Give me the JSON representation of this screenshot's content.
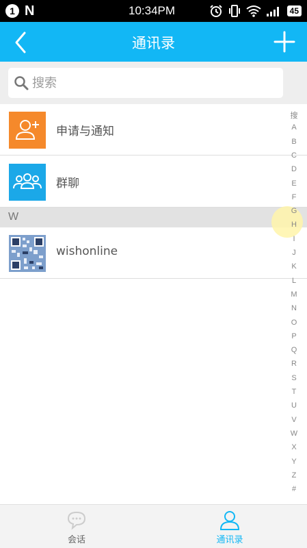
{
  "status_bar": {
    "alert_badge": "1",
    "n_icon": "N",
    "time": "10:34PM",
    "battery": "45"
  },
  "header": {
    "title": "通讯录",
    "back_icon": "chevron-left-icon",
    "add_icon": "plus-icon"
  },
  "search": {
    "placeholder": "搜索"
  },
  "list": {
    "special_items": [
      {
        "label": "申请与通知",
        "icon": "add-contact-icon",
        "color": "#f5892b"
      },
      {
        "label": "群聊",
        "icon": "group-icon",
        "color": "#1ba8e8"
      }
    ],
    "section_letter": "W",
    "contacts": [
      {
        "name": "wishonline",
        "avatar": "qr-code-avatar"
      }
    ]
  },
  "index_bar": [
    "搜",
    "A",
    "B",
    "C",
    "D",
    "E",
    "F",
    "G",
    "H",
    "I",
    "J",
    "K",
    "L",
    "M",
    "N",
    "O",
    "P",
    "Q",
    "R",
    "S",
    "T",
    "U",
    "V",
    "W",
    "X",
    "Y",
    "Z",
    "#"
  ],
  "bottom_nav": {
    "tabs": [
      {
        "label": "会话",
        "icon": "chat-icon",
        "active": false
      },
      {
        "label": "通讯录",
        "icon": "contacts-icon",
        "active": true
      }
    ]
  },
  "colors": {
    "primary": "#12b7f5",
    "orange": "#f5892b",
    "blue": "#1ba8e8"
  }
}
